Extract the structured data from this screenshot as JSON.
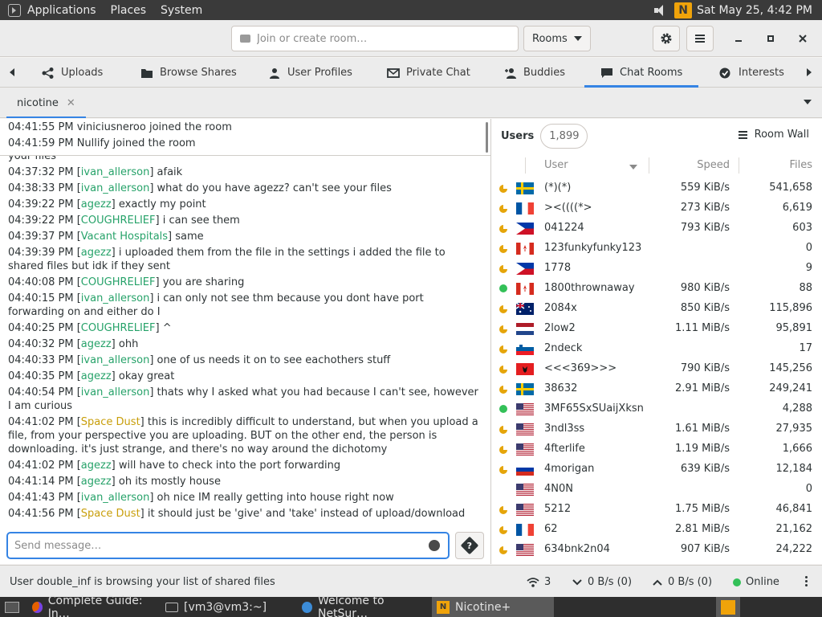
{
  "top_panel": {
    "menus": [
      "Applications",
      "Places",
      "System"
    ],
    "clock": "Sat May 25,  4:42 PM"
  },
  "header": {
    "room_placeholder": "Join or create room…",
    "rooms_label": "Rooms"
  },
  "tabs": [
    {
      "label": "Uploads",
      "icon": "share-icon"
    },
    {
      "label": "Browse Shares",
      "icon": "folder-icon"
    },
    {
      "label": "User Profiles",
      "icon": "person-icon"
    },
    {
      "label": "Private Chat",
      "icon": "mail-icon"
    },
    {
      "label": "Buddies",
      "icon": "add-person-icon"
    },
    {
      "label": "Chat Rooms",
      "icon": "chat-icon",
      "active": true
    },
    {
      "label": "Interests",
      "icon": "check-circle-icon"
    }
  ],
  "room_tab": {
    "label": "nicotine"
  },
  "activity": [
    "04:41:55 PM viniciusneroo joined the room",
    "04:41:59 PM Nullify joined the room"
  ],
  "chat": {
    "partial_line": "your files",
    "messages": [
      {
        "time": "04:37:32 PM",
        "user": "ivan_allerson",
        "color": "green",
        "text": "afaik"
      },
      {
        "time": "04:38:33 PM",
        "user": "ivan_allerson",
        "color": "green",
        "text": "what do you have agezz? can't see your files"
      },
      {
        "time": "04:39:22 PM",
        "user": "agezz",
        "color": "green",
        "text": "exactly my point"
      },
      {
        "time": "04:39:22 PM",
        "user": "COUGHRELIEF",
        "color": "green",
        "text": "i can see them"
      },
      {
        "time": "04:39:37 PM",
        "user": "Vacant Hospitals",
        "color": "green",
        "text": "same"
      },
      {
        "time": "04:39:39 PM",
        "user": "agezz",
        "color": "green",
        "text": "i uploaded them from the file in the settings i added the file to shared files but idk if they sent"
      },
      {
        "time": "04:40:08 PM",
        "user": "COUGHRELIEF",
        "color": "green",
        "text": "you are sharing"
      },
      {
        "time": "04:40:15 PM",
        "user": "ivan_allerson",
        "color": "green",
        "text": "i can only not see thm because you dont have port forwarding on and either do I"
      },
      {
        "time": "04:40:25 PM",
        "user": "COUGHRELIEF",
        "color": "green",
        "text": "^"
      },
      {
        "time": "04:40:32 PM",
        "user": "agezz",
        "color": "green",
        "text": "ohh"
      },
      {
        "time": "04:40:33 PM",
        "user": "ivan_allerson",
        "color": "green",
        "text": "one of us needs it on to see eachothers stuff"
      },
      {
        "time": "04:40:35 PM",
        "user": "agezz",
        "color": "green",
        "text": "okay great"
      },
      {
        "time": "04:40:54 PM",
        "user": "ivan_allerson",
        "color": "green",
        "text": "thats why I asked what you had because I can't see, however I am curious"
      },
      {
        "time": "04:41:02 PM",
        "user": "Space Dust",
        "color": "gold",
        "text": "this is incredibly difficult to understand, but when you upload a file, from your perspective you are uploading. BUT on the other end, the person is downloading. it's just strange, and there's no way around the dichotomy"
      },
      {
        "time": "04:41:02 PM",
        "user": "agezz",
        "color": "green",
        "text": "will have to check into the port forwarding"
      },
      {
        "time": "04:41:14 PM",
        "user": "agezz",
        "color": "green",
        "text": "oh its mostly house"
      },
      {
        "time": "04:41:43 PM",
        "user": "ivan_allerson",
        "color": "green",
        "text": "oh nice IM really getting into house right now"
      },
      {
        "time": "04:41:56 PM",
        "user": "Space Dust",
        "color": "gold",
        "text": "it should just be 'give' and 'take' instead of upload/download"
      }
    ],
    "composer_placeholder": "Send message…"
  },
  "users_panel": {
    "label": "Users",
    "count": "1,899",
    "room_wall": "Room Wall",
    "columns": {
      "user": "User",
      "speed": "Speed",
      "files": "Files"
    },
    "rows": [
      {
        "status": "away",
        "flag": "SE",
        "name": "(*)(*)",
        "speed": "559 KiB/s",
        "files": "541,658"
      },
      {
        "status": "away",
        "flag": "FR",
        "name": "><((((*>",
        "speed": "273 KiB/s",
        "files": "6,619"
      },
      {
        "status": "away",
        "flag": "PH",
        "name": "041224",
        "speed": "793 KiB/s",
        "files": "603"
      },
      {
        "status": "away",
        "flag": "CA",
        "name": "123funkyfunky123",
        "speed": "",
        "files": "0"
      },
      {
        "status": "away",
        "flag": "PH",
        "name": "1778",
        "speed": "",
        "files": "9"
      },
      {
        "status": "online",
        "flag": "CA",
        "name": "1800thrownaway",
        "speed": "980 KiB/s",
        "files": "88"
      },
      {
        "status": "away",
        "flag": "AU",
        "name": "2084x",
        "speed": "850 KiB/s",
        "files": "115,896"
      },
      {
        "status": "away",
        "flag": "NL",
        "name": "2low2",
        "speed": "1.11 MiB/s",
        "files": "95,891"
      },
      {
        "status": "away",
        "flag": "SI",
        "name": "2ndeck",
        "speed": "",
        "files": "17"
      },
      {
        "status": "away",
        "flag": "AL",
        "name": "<<<369>>>",
        "speed": "790 KiB/s",
        "files": "145,256"
      },
      {
        "status": "away",
        "flag": "SE",
        "name": "38632",
        "speed": "2.91 MiB/s",
        "files": "249,241"
      },
      {
        "status": "online",
        "flag": "US",
        "name": "3MF65SxSUaijXksn",
        "speed": "",
        "files": "4,288"
      },
      {
        "status": "away",
        "flag": "US",
        "name": "3ndl3ss",
        "speed": "1.61 MiB/s",
        "files": "27,935"
      },
      {
        "status": "away",
        "flag": "US",
        "name": "4fterlife",
        "speed": "1.19 MiB/s",
        "files": "1,666"
      },
      {
        "status": "away",
        "flag": "RU",
        "name": "4morigan",
        "speed": "639 KiB/s",
        "files": "12,184"
      },
      {
        "status": "none",
        "flag": "US",
        "name": "4N0N",
        "speed": "",
        "files": "0"
      },
      {
        "status": "away",
        "flag": "US",
        "name": "5212",
        "speed": "1.75 MiB/s",
        "files": "46,841"
      },
      {
        "status": "away",
        "flag": "FR",
        "name": "62",
        "speed": "2.81 MiB/s",
        "files": "21,162"
      },
      {
        "status": "away",
        "flag": "US",
        "name": "634bnk2n04",
        "speed": "907 KiB/s",
        "files": "24,222"
      }
    ]
  },
  "status_bar": {
    "message": "User double_inf is browsing your list of shared files",
    "connections": "3",
    "download_speed": "0 B/s (0)",
    "upload_speed": "0 B/s (0)",
    "online": "Online"
  },
  "taskbar": [
    {
      "label": "Complete Guide: In…",
      "icon": "firefox-icon"
    },
    {
      "label": "[vm3@vm3:~]",
      "icon": "terminal-icon"
    },
    {
      "label": "Welcome to NetSur…",
      "icon": "netsurf-icon"
    },
    {
      "label": "Nicotine+",
      "icon": "nicotine-icon",
      "active": true
    }
  ],
  "colors": {
    "accent": "#3584e4",
    "username_green": "#26a269",
    "username_gold": "#c89e0a",
    "away": "#e5a50a",
    "online": "#33c058"
  }
}
